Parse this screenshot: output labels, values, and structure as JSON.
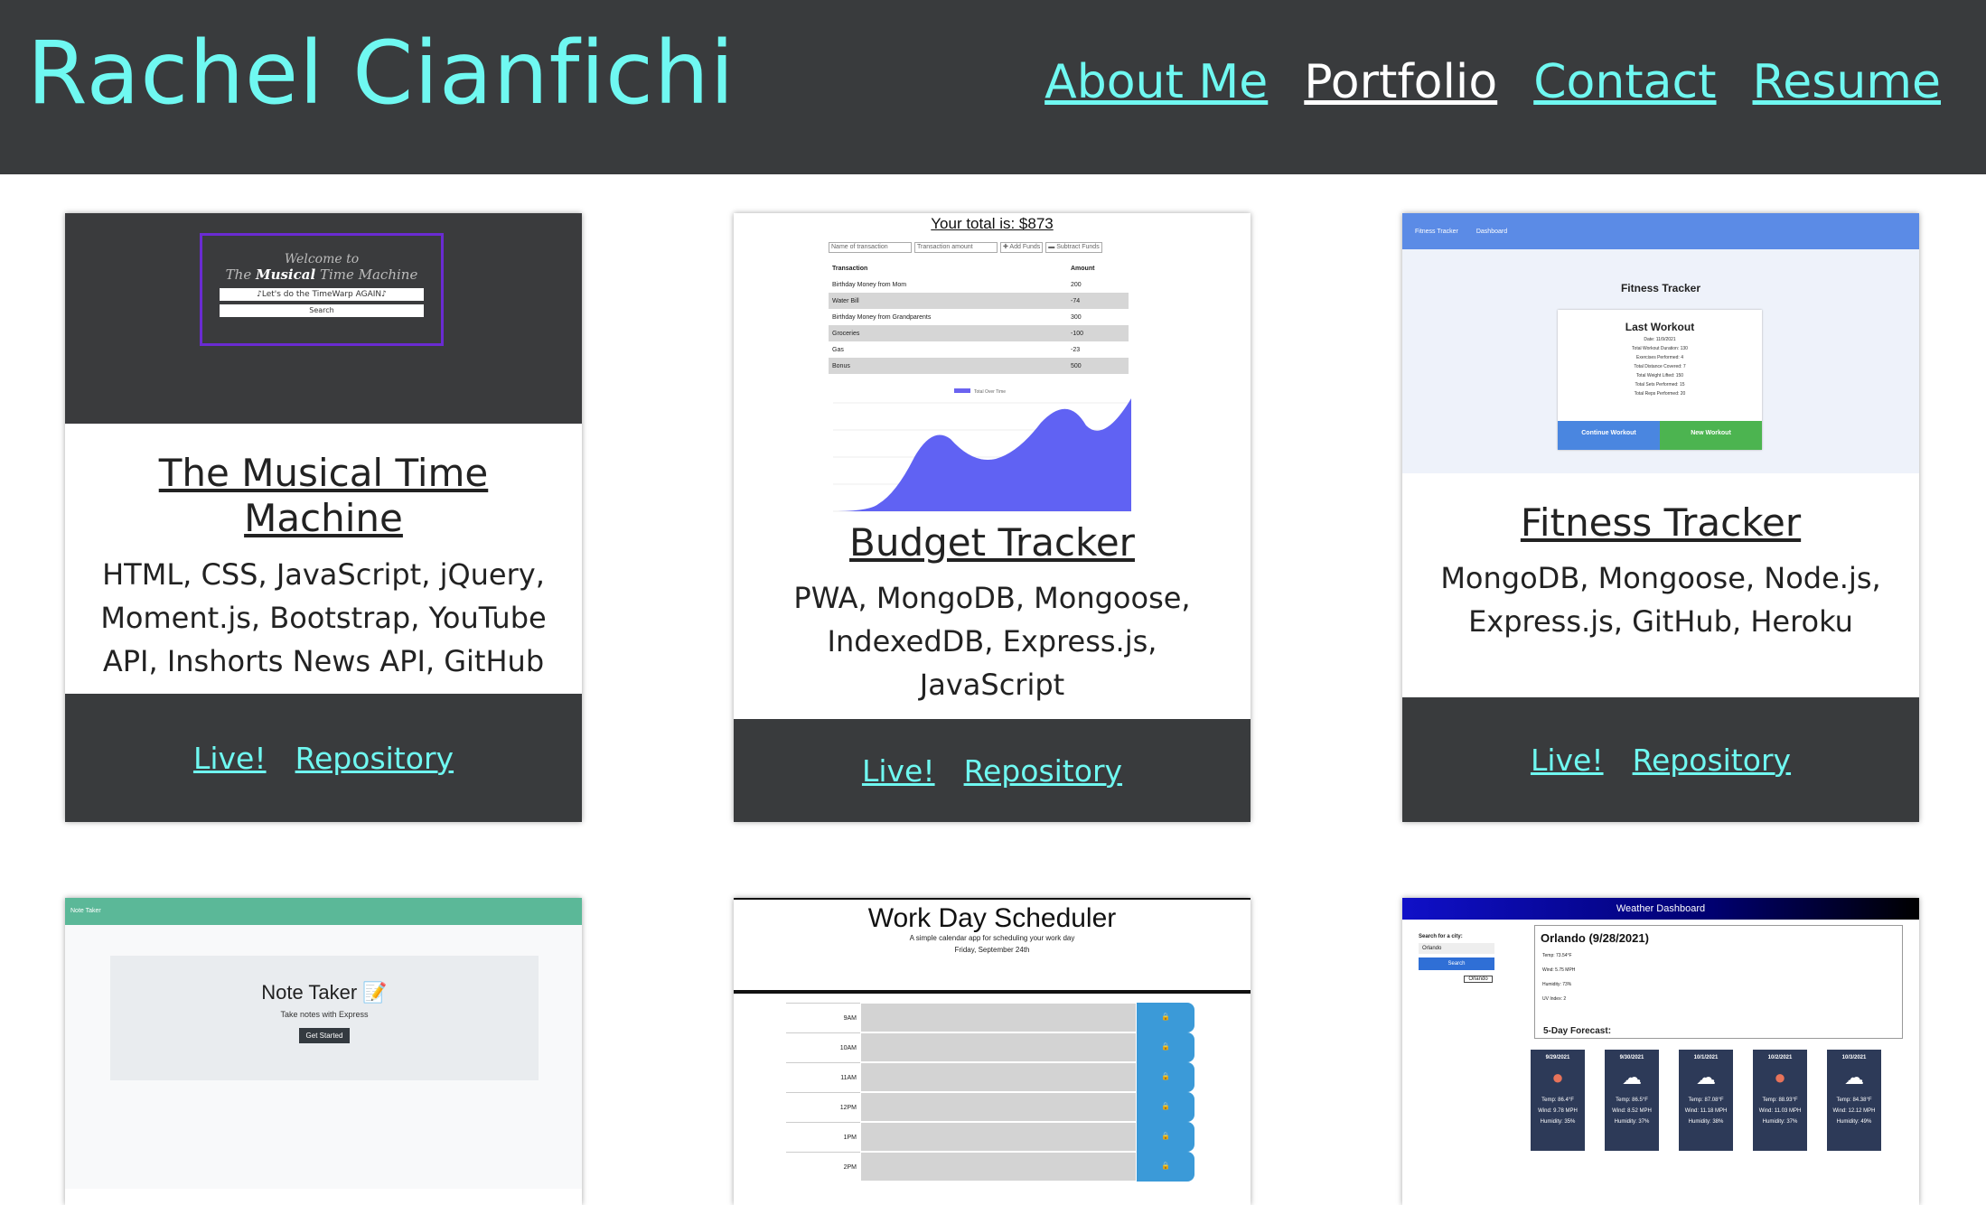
{
  "site": {
    "name": "Rachel Cianfichi"
  },
  "nav": [
    {
      "label": "About Me",
      "active": false
    },
    {
      "label": "Portfolio",
      "active": true
    },
    {
      "label": "Contact",
      "active": false
    },
    {
      "label": "Resume",
      "active": false
    }
  ],
  "colors": {
    "header_bg": "#393b3d",
    "accent": "#6ff8f1",
    "active_link": "#ffffff"
  },
  "projects": [
    {
      "title": "The Musical Time Machine",
      "tech": "HTML, CSS, JavaScript, jQuery, Moment.js, Bootstrap, YouTube API, Inshorts News API, GitHub",
      "live_label": "Live!",
      "repo_label": "Repository",
      "thumb": {
        "line1": "Welcome to",
        "line2a": "The ",
        "line2b": "Musical",
        "line2c": " Time Machine",
        "input": "♪Let's do the TimeWarp AGAIN♪",
        "button": "Search"
      }
    },
    {
      "title": "Budget Tracker",
      "tech": "PWA, MongoDB, Mongoose, IndexedDB, Express.js, JavaScript",
      "live_label": "Live!",
      "repo_label": "Repository",
      "thumb": {
        "total": "Your total is: $873",
        "name_placeholder": "Name of transaction",
        "amount_placeholder": "Transaction amount",
        "add": "✚ Add Funds",
        "subtract": "▬ Subtract Funds",
        "col_transaction": "Transaction",
        "col_amount": "Amount",
        "rows": [
          [
            "Birthday Money from Mom",
            "200"
          ],
          [
            "Water Bill",
            "-74"
          ],
          [
            "Birthday Money from Grandparents",
            "300"
          ],
          [
            "Groceries",
            "-100"
          ],
          [
            "Gas",
            "-23"
          ],
          [
            "Bonus",
            "500"
          ]
        ],
        "legend": "Total Over Time"
      }
    },
    {
      "title": "Fitness Tracker",
      "tech": "MongoDB, Mongoose, Node.js, Express.js, GitHub, Heroku",
      "live_label": "Live!",
      "repo_label": "Repository",
      "thumb": {
        "nav1": "Fitness Tracker",
        "nav2": "Dashboard",
        "heading": "Fitness Tracker",
        "panel_title": "Last Workout",
        "lines": [
          "Date: 11/9/2021",
          "Total Workout Duration: 130",
          "Exercises Performed: 4",
          "Total Distance Covered: 7",
          "Total Weight Lifted: 150",
          "Total Sets Performed: 15",
          "Total Reps Performed: 20"
        ],
        "continue": "Continue Workout",
        "new": "New Workout"
      }
    },
    {
      "title": "Note Taker",
      "thumb": {
        "bar": "Note Taker",
        "title": "Note Taker 📝",
        "subtitle": "Take notes with Express",
        "button": "Get Started"
      }
    },
    {
      "title": "Work Day Scheduler",
      "thumb": {
        "title": "Work Day Scheduler",
        "subtitle": "A simple calendar app for scheduling your work day",
        "date": "Friday, September 24th",
        "hours": [
          "9AM",
          "10AM",
          "11AM",
          "12PM",
          "1PM",
          "2PM"
        ],
        "save_icon": "🔒"
      }
    },
    {
      "title": "Weather Dashboard",
      "thumb": {
        "bar": "Weather Dashboard",
        "search_label": "Search for a city:",
        "search_value": "Orlando",
        "search_button": "Search",
        "history_city": "Orlando",
        "city_title": "Orlando (9/28/2021)",
        "today_lines": [
          "Temp: 73.54°F",
          "Wind: 5.75 MPH",
          "Humidity: 73%",
          "UV Index: 2"
        ],
        "forecast_title": "5-Day Forecast:",
        "forecast": [
          {
            "date": "9/29/2021",
            "icon": "●",
            "temp": "Temp: 86.4°F",
            "wind": "Wind: 9.78 MPH",
            "humidity": "Humidity: 35%"
          },
          {
            "date": "9/30/2021",
            "icon": "☁",
            "temp": "Temp: 86.5°F",
            "wind": "Wind: 8.52 MPH",
            "humidity": "Humidity: 37%"
          },
          {
            "date": "10/1/2021",
            "icon": "☁",
            "temp": "Temp: 87.08°F",
            "wind": "Wind: 11.18 MPH",
            "humidity": "Humidity: 38%"
          },
          {
            "date": "10/2/2021",
            "icon": "●",
            "temp": "Temp: 88.93°F",
            "wind": "Wind: 11.03 MPH",
            "humidity": "Humidity: 37%"
          },
          {
            "date": "10/3/2021",
            "icon": "☁",
            "temp": "Temp: 84.38°F",
            "wind": "Wind: 12.12 MPH",
            "humidity": "Humidity: 49%"
          }
        ]
      }
    }
  ]
}
